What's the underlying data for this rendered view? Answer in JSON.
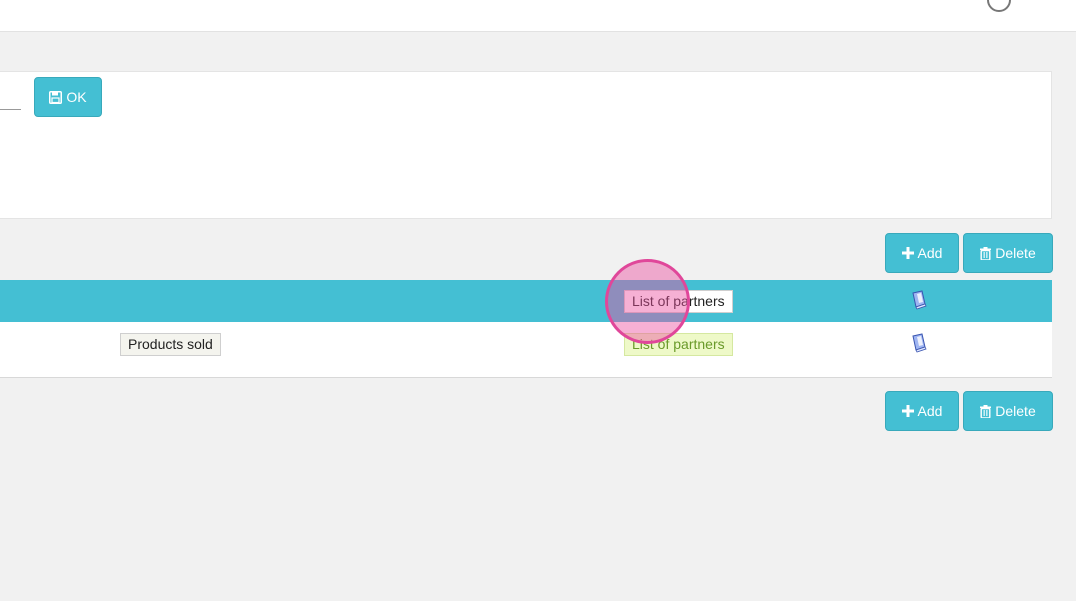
{
  "header": {
    "icons": [
      "help-icon",
      "bookmark-icon"
    ]
  },
  "form": {
    "ok_label": "OK",
    "ok_icon": "floppy-disk-icon"
  },
  "toolbar_top": {
    "add_label": "Add",
    "delete_label": "Delete"
  },
  "toolbar_bottom": {
    "add_label": "Add",
    "delete_label": "Delete"
  },
  "table": {
    "header": {
      "partners_tag": "List of partners",
      "icon": "book-icon"
    },
    "rows": [
      {
        "name_tag": "Products sold",
        "partners_tag": "List of partners",
        "icon": "book-icon"
      }
    ]
  },
  "colors": {
    "accent": "#44bfd3",
    "background": "#f1f1f1",
    "cursor_highlight": "#e0479a"
  }
}
